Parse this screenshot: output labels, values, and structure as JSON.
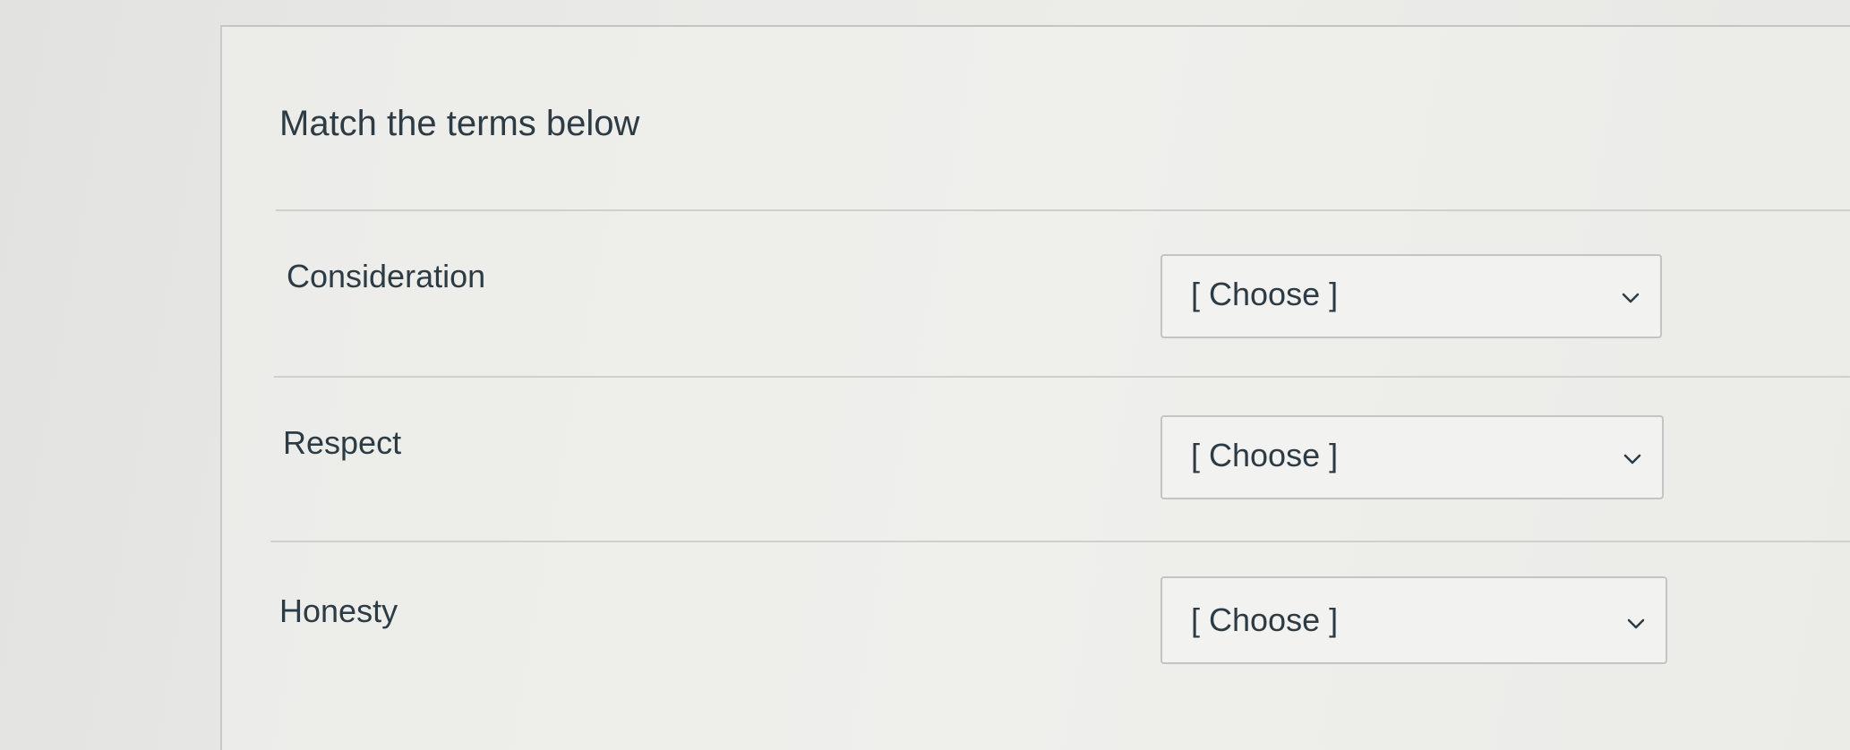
{
  "question": {
    "prompt": "Match the terms below"
  },
  "rows": [
    {
      "term": "Consideration",
      "selected": "[ Choose ]"
    },
    {
      "term": "Respect",
      "selected": "[ Choose ]"
    },
    {
      "term": "Honesty",
      "selected": "[ Choose ]"
    }
  ],
  "icons": {
    "dropdown": "chevron-down-icon"
  },
  "colors": {
    "text": "#2d3b45",
    "border": "#c4c4c4"
  }
}
